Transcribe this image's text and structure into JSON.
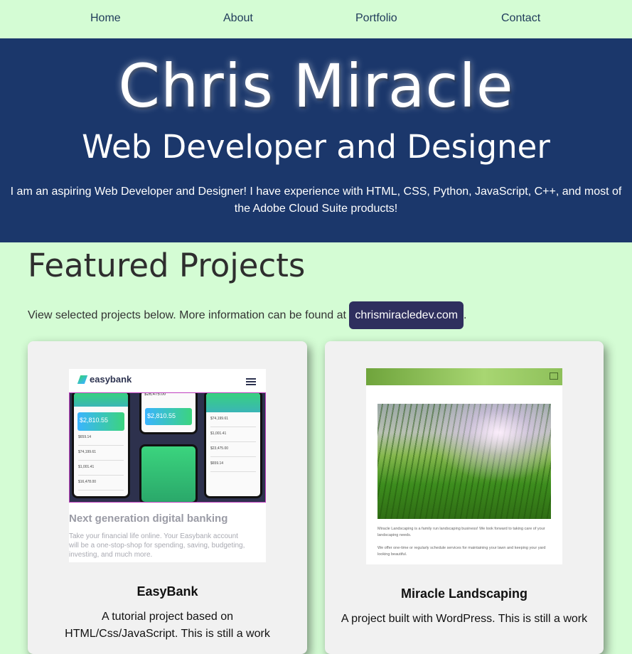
{
  "nav": {
    "items": [
      "Home",
      "About",
      "Portfolio",
      "Contact"
    ]
  },
  "hero": {
    "name": "Chris Miracle",
    "role": "Web Developer and Designer",
    "bio": "I am an aspiring Web Developer and Designer! I have experience with HTML, CSS, Python, JavaScript, C++, and most of the Adobe Cloud Suite products!"
  },
  "featured": {
    "title": "Featured Projects",
    "intro": "View selected projects below. More information can be found at",
    "link_label": "chrismiracledev.com",
    "intro_end": "."
  },
  "projects": [
    {
      "title": "EasyBank",
      "description": "A tutorial project based on HTML/Css/JavaScript. This is still a work",
      "thumb": {
        "logo": "easybank",
        "headline": "Next generation digital banking",
        "text": "Take your financial life online. Your Easybank account will be a one-stop-shop for spending, saving, budgeting, investing, and much more.",
        "balance_1": "$2,810.55",
        "balance_2": "$2,810.55",
        "top_value": "$26,475.00",
        "rows_a": [
          "$659.14",
          "$74,199.61",
          "$1,001.41",
          "$16,478.00"
        ],
        "rows_b": [
          "$74,199.61",
          "$1,001.41",
          "$23,475.00",
          "$659.14"
        ]
      }
    },
    {
      "title": "Miracle Landscaping",
      "description": "A project built with WordPress. This is still a work",
      "thumb": {
        "text_1": "Miracle Landscaping is a family run landscaping business! We look forward to taking care of your landscaping needs.",
        "text_2": "We offer one-time or regularly schedule services for maintaining your lawn and keeping your yard looking beautiful."
      }
    }
  ],
  "colors": {
    "page_bg": "#d4fcd4",
    "hero_bg": "#1b376b",
    "pill_bg": "#2f2f5e",
    "card_bg": "#f1f1f1"
  }
}
